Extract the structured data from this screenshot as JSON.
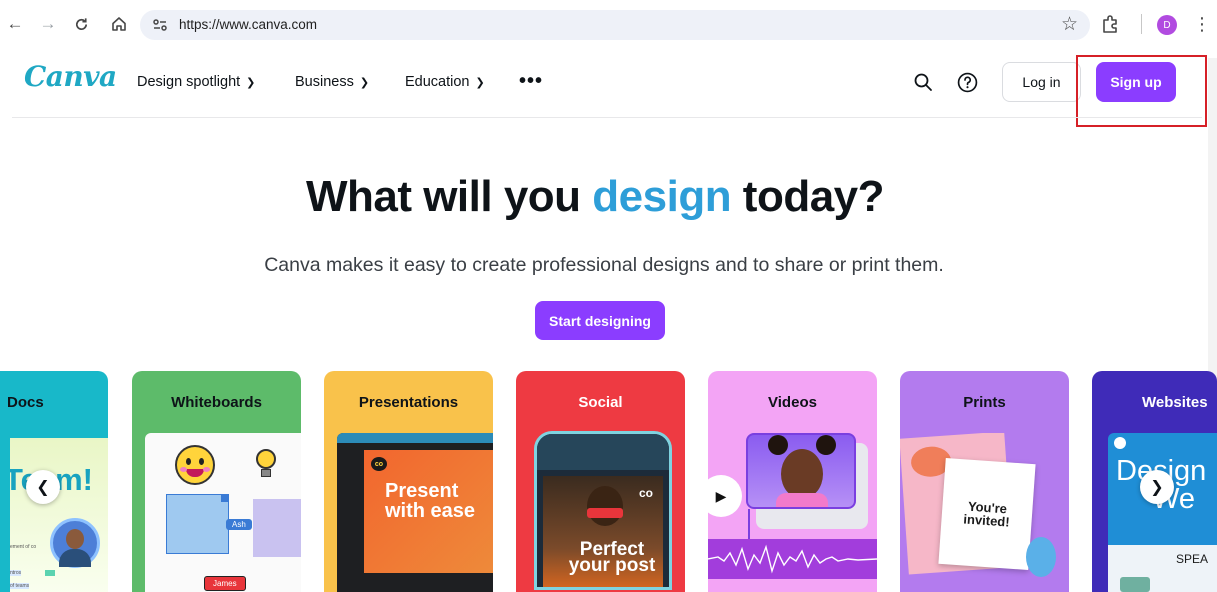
{
  "browser": {
    "url": "https://www.canva.com",
    "profile_initial": "D"
  },
  "header": {
    "logo": "Canva",
    "nav": [
      "Design spotlight",
      "Business",
      "Education"
    ],
    "login_label": "Log in",
    "signup_label": "Sign up"
  },
  "hero": {
    "title_before": "What will you ",
    "title_accent": "design",
    "title_after": " today?",
    "subtitle": "Canva makes it easy to create professional designs and to share or print them.",
    "cta": "Start designing"
  },
  "cards": [
    {
      "title": "Docs",
      "bg": "#18b8c9"
    },
    {
      "title": "Whiteboards",
      "bg": "#5dbb6a"
    },
    {
      "title": "Presentations",
      "bg": "#f9c24b"
    },
    {
      "title": "Social",
      "bg": "#ee3a42"
    },
    {
      "title": "Videos",
      "bg": "#f3a4f5"
    },
    {
      "title": "Prints",
      "bg": "#b37bee"
    },
    {
      "title": "Websites",
      "bg": "#3f2bb8"
    }
  ],
  "card_art": {
    "docs_text": "Team!",
    "docs_small": [
      "ement of co",
      "ntros",
      "of teams"
    ],
    "wb_label_a": "Ash",
    "wb_label_b": "James",
    "pres_text": "Present with ease",
    "social_text": "Perfect your post",
    "prints_text": "You're invited!",
    "web_text_a": "Design",
    "web_text_b": "We",
    "web_speak": "SPEA"
  },
  "colors": {
    "accent": "#8b3dff",
    "brand": "#1fa8c4",
    "title_accent": "#2e9ed8",
    "highlight": "#d62027"
  }
}
